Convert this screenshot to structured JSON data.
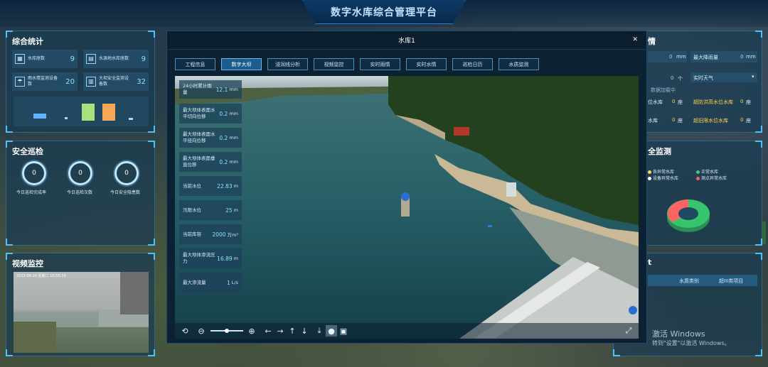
{
  "app": {
    "title": "数字水库综合管理平台"
  },
  "left": {
    "stats_title": "综合统计",
    "stats": [
      {
        "icon": "building-icon",
        "label": "水库座数",
        "value": "9"
      },
      {
        "icon": "gauge-icon",
        "label": "水源地水库座数",
        "value": "9"
      },
      {
        "icon": "rain-icon",
        "label": "雨水情监测设备数",
        "value": "20"
      },
      {
        "icon": "dam-icon",
        "label": "大坝安全监测设备数",
        "value": "32"
      }
    ],
    "safety_title": "安全巡检",
    "safety": [
      {
        "label": "今日巡检完成率",
        "value": "0"
      },
      {
        "label": "今日巡检次数",
        "value": "0"
      },
      {
        "label": "今日安全隐患数",
        "value": "0"
      }
    ],
    "video_title": "视频监控",
    "video_overlay": "2023-06-20 星期二 10:55:19"
  },
  "modal": {
    "title": "水库1",
    "tabs": [
      "工程信息",
      "数字大坝",
      "浸润线分析",
      "视频监控",
      "实时雨情",
      "实时水情",
      "巡检日历",
      "水质监测"
    ],
    "active_tab": 1,
    "metrics": [
      {
        "label": "24小时累计雨量",
        "value": "12.1",
        "unit": "mm"
      },
      {
        "label": "最大坝体表面水平切向位移",
        "value": "0.2",
        "unit": "mm"
      },
      {
        "label": "最大坝体表面水平径向位移",
        "value": "0.2",
        "unit": "mm"
      },
      {
        "label": "最大坝体表面垂直位移",
        "value": "0.2",
        "unit": "mm"
      },
      {
        "label": "当前水位",
        "value": "22.83",
        "unit": "m"
      },
      {
        "label": "汛限水位",
        "value": "25",
        "unit": "m"
      },
      {
        "label": "当前库容",
        "value": "2000",
        "unit": "万m³"
      },
      {
        "label": "最大坝体渗流压力",
        "value": "16.89",
        "unit": "m"
      },
      {
        "label": "最大渗流量",
        "value": "1",
        "unit": "L/s"
      }
    ]
  },
  "right": {
    "rain_title": "情",
    "r1a_val": "0",
    "r1a_unit": "mm",
    "r1b_label": "最大降雨量",
    "r1b_val": "0",
    "r1b_unit": "mm",
    "r2a_val": "0",
    "r2a_unit": "个",
    "r2b_label": "实时天气",
    "r2c_text": "数据加载中",
    "r3a_label": "位水库",
    "r3a_val": "0",
    "r3a_unit": "座",
    "r3b_label": "超防洪高水位水库",
    "r3b_val": "0",
    "r3b_unit": "座",
    "r4a_label": "水库",
    "r4a_val": "0",
    "r4a_unit": "座",
    "r4b_label": "超旧限水位水库",
    "r4b_val": "0",
    "r4b_unit": "座",
    "safety_title": "全监测",
    "legend": [
      {
        "label": "各异常水库",
        "color": "#f4e04d"
      },
      {
        "label": "正常水库",
        "color": "#36d17a"
      },
      {
        "label": "设备异常水库",
        "color": "#ffffff"
      },
      {
        "label": "测点异常水库",
        "color": "#ff5a5a"
      }
    ],
    "quality_title": "t",
    "quality_cols": [
      "水质类别",
      "超III类项目"
    ]
  },
  "watermark": {
    "line1": "激活 Windows",
    "line2": "转到\"设置\"以激活 Windows。"
  },
  "colors": {
    "accent": "#4fc3f7",
    "value": "#8fe0ff",
    "active_tab": "#1b5d8e"
  }
}
